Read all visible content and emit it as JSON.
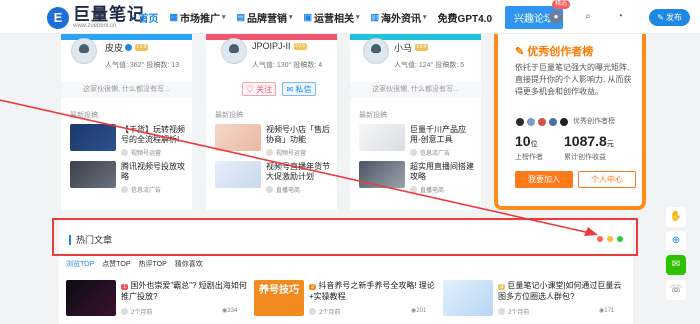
{
  "header": {
    "logo_mark": "E",
    "logo_cn": "巨量笔记",
    "logo_en": "www.zuebeni.cn",
    "nav": [
      {
        "label": "首页",
        "active": true,
        "dropdown": false
      },
      {
        "label": "市场推广",
        "active": false,
        "dropdown": true
      },
      {
        "label": "品牌营销",
        "active": false,
        "dropdown": true
      },
      {
        "label": "运营相关",
        "active": false,
        "dropdown": true
      },
      {
        "label": "海外资讯",
        "active": false,
        "dropdown": true
      },
      {
        "label": "免费GPT4.0",
        "active": false,
        "dropdown": false
      }
    ],
    "forum_btn": "兴趣论坛",
    "forum_badge": "精选",
    "post_btn": "发布",
    "icons": [
      "globe-icon",
      "search-icon",
      "bell-icon",
      "avatar-icon"
    ]
  },
  "users": [
    {
      "name": "皮皮",
      "level": "LV.6",
      "verified": true,
      "stats": "人气值: 362°  投稿数: 13",
      "signature": "这家伙很懒, 什么都没有写...",
      "latest_label": "最新投稿",
      "posts": [
        {
          "title": "【干货】玩转视频号的全流程解析!",
          "tag": "视频号运营"
        },
        {
          "title": "腾讯视频号投放攻略",
          "tag": "信息流广告"
        }
      ]
    },
    {
      "name": "JPOIPJ-II",
      "level": "LV.6",
      "verified": false,
      "stats": "人气值: 130°  投稿数: 4",
      "follow": "关注",
      "message": "私信",
      "latest_label": "最新投稿",
      "posts": [
        {
          "title": "视频号小店「售后协商」功能",
          "tag": "视频号运营"
        },
        {
          "title": "视频号直播年货节大促激励计划",
          "tag": "直播电商"
        }
      ]
    },
    {
      "name": "小马",
      "level": "LV.4",
      "verified": false,
      "stats": "人气值: 124°  投稿数: 5",
      "signature": "这家伙很懒, 什么都没有写...",
      "latest_label": "最新投稿",
      "posts": [
        {
          "title": "巨量千川产品应用-创意工具",
          "tag": "信息流广告"
        },
        {
          "title": "超实用直播间搭建攻略",
          "tag": "直播电商"
        }
      ]
    }
  ],
  "creator": {
    "title": "优秀创作者榜",
    "desc": "依托于巨量笔记强大的曝光矩阵, 直接提升你的个人影响力, 从而获得更多机会和创作收益。",
    "avatars_label": "优秀创作者榜",
    "count_value": "10",
    "count_unit": "位",
    "count_label": "上榜作者",
    "income_value": "1087.8",
    "income_unit": "元",
    "income_label": "累计创作收益",
    "join_btn": "我要加入",
    "center_btn": "个人中心"
  },
  "hot": {
    "title": "热门文章",
    "tabs": [
      "浏览TOP",
      "点赞TOP",
      "热评TOP",
      "猜你喜欢"
    ],
    "articles": [
      {
        "title": "国外也崇爱\"霸总\"? 短剧出海如何推广投放?",
        "time": "2个月前",
        "views": "334"
      },
      {
        "title": "抖音养号之新手养号全攻略! 理论+实操教程",
        "time": "2个月前",
        "views": "201",
        "thumb_text": "养号技巧"
      },
      {
        "title": "巨量笔记小课堂|如何通过巨量云图多方位圈选人群包?",
        "time": "2个月前",
        "views": "171"
      }
    ]
  },
  "colors": {
    "accent": "#1e88e5",
    "strip1": "#2aa3f5",
    "strip2": "#f0566e",
    "strip3": "#22c2d8",
    "creator_orange": "#ff7a1a",
    "annotation_red": "#ec3b3b"
  }
}
